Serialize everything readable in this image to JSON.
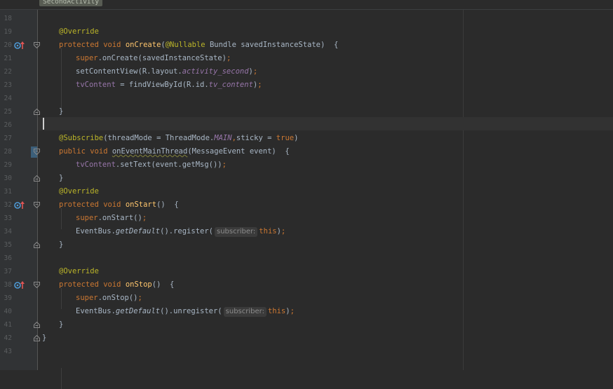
{
  "editor": {
    "breadcrumb": "SecondActivity",
    "lines": [
      {
        "n": "18",
        "seg": []
      },
      {
        "n": "19",
        "seg": [
          {
            "c": "ann",
            "t": "@Override"
          }
        ]
      },
      {
        "n": "20",
        "seg": [
          {
            "c": "kw",
            "t": "protected void "
          },
          {
            "c": "fn",
            "t": "onCreate"
          },
          {
            "c": "",
            "t": "("
          },
          {
            "c": "ann",
            "t": "@Nullable"
          },
          {
            "c": "",
            "t": " Bundle savedInstanceState)  {"
          }
        ]
      },
      {
        "n": "21",
        "seg": [
          {
            "c": "kw",
            "t": "super"
          },
          {
            "c": "",
            "t": ".onCreate(savedInstanceState)"
          },
          {
            "c": "kw",
            "t": ";"
          }
        ]
      },
      {
        "n": "22",
        "seg": [
          {
            "c": "",
            "t": "setContentView(R.layout."
          },
          {
            "c": "sfield",
            "t": "activity_second"
          },
          {
            "c": "",
            "t": ")"
          },
          {
            "c": "kw",
            "t": ";"
          }
        ]
      },
      {
        "n": "23",
        "seg": [
          {
            "c": "field",
            "t": "tvContent"
          },
          {
            "c": "",
            "t": " = findViewById(R.id."
          },
          {
            "c": "sfield",
            "t": "tv_content"
          },
          {
            "c": "",
            "t": ")"
          },
          {
            "c": "kw",
            "t": ";"
          }
        ]
      },
      {
        "n": "24",
        "seg": []
      },
      {
        "n": "25",
        "seg": [
          {
            "c": "",
            "t": "}"
          }
        ]
      },
      {
        "n": "26",
        "seg": []
      },
      {
        "n": "27",
        "seg": [
          {
            "c": "ann",
            "t": "@Subscribe"
          },
          {
            "c": "",
            "t": "(threadMode = ThreadMode."
          },
          {
            "c": "sfield",
            "t": "MAIN"
          },
          {
            "c": "kw",
            "t": ","
          },
          {
            "c": "",
            "t": "sticky = "
          },
          {
            "c": "kw",
            "t": "true"
          },
          {
            "c": "",
            "t": ")"
          }
        ]
      },
      {
        "n": "28",
        "seg": [
          {
            "c": "kw",
            "t": "public void "
          },
          {
            "c": "warn",
            "t": "onEventMainThread"
          },
          {
            "c": "",
            "t": "(MessageEvent event)  {"
          }
        ]
      },
      {
        "n": "29",
        "seg": [
          {
            "c": "field",
            "t": "tvContent"
          },
          {
            "c": "",
            "t": ".setText(event.getMsg())"
          },
          {
            "c": "kw",
            "t": ";"
          }
        ]
      },
      {
        "n": "30",
        "seg": [
          {
            "c": "",
            "t": "}"
          }
        ]
      },
      {
        "n": "31",
        "seg": [
          {
            "c": "ann",
            "t": "@Override"
          }
        ]
      },
      {
        "n": "32",
        "seg": [
          {
            "c": "kw",
            "t": "protected void "
          },
          {
            "c": "fn",
            "t": "onStart"
          },
          {
            "c": "",
            "t": "()  {"
          }
        ]
      },
      {
        "n": "33",
        "seg": [
          {
            "c": "kw",
            "t": "super"
          },
          {
            "c": "",
            "t": ".onStart()"
          },
          {
            "c": "kw",
            "t": ";"
          }
        ]
      },
      {
        "n": "34",
        "seg": [
          {
            "c": "",
            "t": "EventBus."
          },
          {
            "c": "static-m",
            "t": "getDefault"
          },
          {
            "c": "",
            "t": "().register("
          },
          {
            "c": "hint",
            "t": "subscriber:"
          },
          {
            "c": "kw",
            "t": "this"
          },
          {
            "c": "",
            "t": ")"
          },
          {
            "c": "kw",
            "t": ";"
          }
        ]
      },
      {
        "n": "35",
        "seg": [
          {
            "c": "",
            "t": "}"
          }
        ]
      },
      {
        "n": "36",
        "seg": []
      },
      {
        "n": "37",
        "seg": [
          {
            "c": "ann",
            "t": "@Override"
          }
        ]
      },
      {
        "n": "38",
        "seg": [
          {
            "c": "kw",
            "t": "protected void "
          },
          {
            "c": "fn",
            "t": "onStop"
          },
          {
            "c": "",
            "t": "()  {"
          }
        ]
      },
      {
        "n": "39",
        "seg": [
          {
            "c": "kw",
            "t": "super"
          },
          {
            "c": "",
            "t": ".onStop()"
          },
          {
            "c": "kw",
            "t": ";"
          }
        ]
      },
      {
        "n": "40",
        "seg": [
          {
            "c": "",
            "t": "EventBus."
          },
          {
            "c": "static-m",
            "t": "getDefault"
          },
          {
            "c": "",
            "t": "().unregister("
          },
          {
            "c": "hint",
            "t": "subscriber:"
          },
          {
            "c": "kw",
            "t": "this"
          },
          {
            "c": "",
            "t": ")"
          },
          {
            "c": "kw",
            "t": ";"
          }
        ]
      },
      {
        "n": "41",
        "seg": [
          {
            "c": "",
            "t": "}"
          }
        ]
      },
      {
        "n": "42",
        "seg": [
          {
            "c": "",
            "t": "}"
          }
        ]
      },
      {
        "n": "43",
        "seg": []
      }
    ]
  },
  "gutter_icons": {
    "override_marker": "override-arrow-icon",
    "fold_marker": "fold-icon"
  },
  "colors": {
    "background": "#2b2b2b",
    "keyword": "#cc7832",
    "annotation": "#bbb529",
    "method": "#ffc66d",
    "field": "#9876aa"
  }
}
